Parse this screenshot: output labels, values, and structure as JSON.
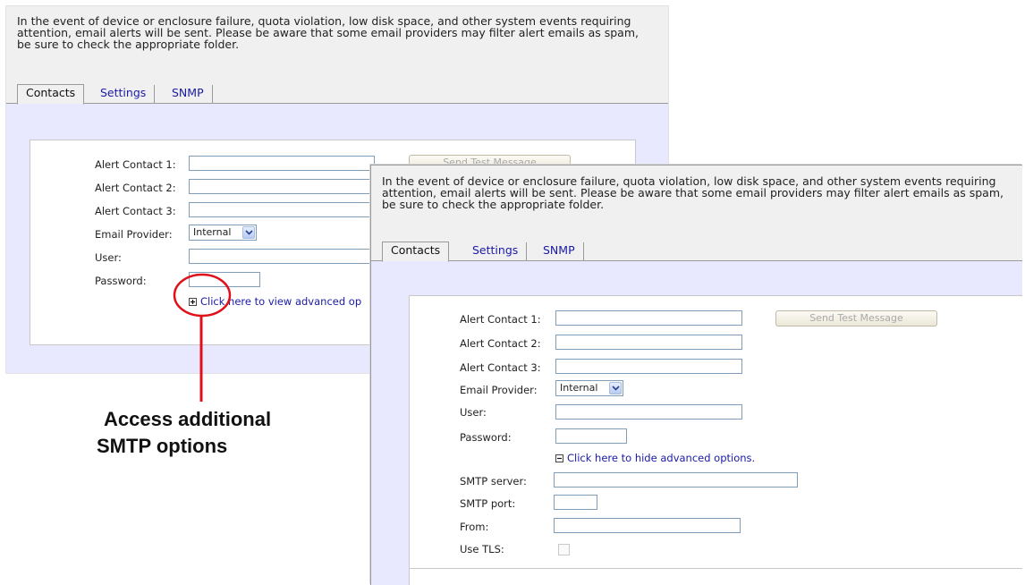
{
  "intro_text": "In the event of device or enclosure failure, quota violation, low disk space, and other system events requiring attention, email alerts will be sent. Please be aware that some email providers may filter alert emails as spam, be sure to check the appropriate folder.",
  "tabs": [
    {
      "label": "Contacts",
      "active": true
    },
    {
      "label": "Settings",
      "active": false
    },
    {
      "label": "SNMP",
      "active": false
    }
  ],
  "form": {
    "alert_contact_1": "Alert Contact 1:",
    "alert_contact_2": "Alert Contact 2:",
    "alert_contact_3": "Alert Contact 3:",
    "email_provider": "Email Provider:",
    "email_provider_value": "Internal",
    "user": "User:",
    "password": "Password:",
    "send_test": "Send Test Message",
    "view_advanced": "Click here to view advanced options.",
    "view_advanced_visible": "Click here to view advanced op",
    "hide_advanced": "Click here to hide advanced options.",
    "smtp_server": "SMTP server:",
    "smtp_port": "SMTP port:",
    "from": "From:",
    "use_tls": "Use TLS:"
  },
  "callout": {
    "line1": "Access additional",
    "line2": "SMTP options",
    "color": "#e0101a"
  },
  "icons": {
    "expand": "plus-box-icon",
    "collapse": "minus-box-icon",
    "dropdown": "chevron-down-icon"
  }
}
